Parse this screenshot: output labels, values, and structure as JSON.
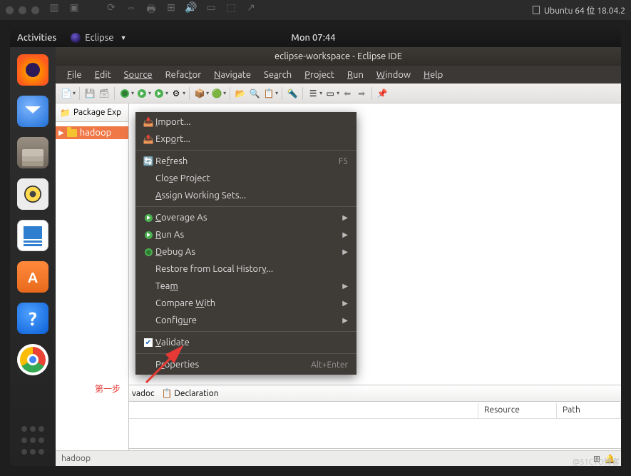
{
  "vm": {
    "title": "Ubuntu 64 位 18.04.2"
  },
  "ubuntu": {
    "activities": "Activities",
    "app_name": "Eclipse",
    "clock": "Mon 07:44"
  },
  "dock": {
    "firefox": "firefox",
    "thunderbird": "thunderbird",
    "files": "files",
    "rhythmbox": "rhythmbox",
    "writer": "libreoffice-writer",
    "software": "ubuntu-software",
    "help": "?",
    "chrome": "chrome",
    "apps": "show-apps"
  },
  "eclipse": {
    "title": "eclipse-workspace - Eclipse IDE",
    "menu": {
      "file": "File",
      "edit": "Edit",
      "source": "Source",
      "refactor": "Refactor",
      "navigate": "Navigate",
      "search": "Search",
      "project": "Project",
      "run": "Run",
      "window": "Window",
      "help": "Help"
    },
    "pkg_tab": "Package Exp",
    "tree": {
      "item0": "hadoop"
    },
    "bottom": {
      "javadoc": "vadoc",
      "declaration": "Declaration"
    },
    "table": {
      "desc": "",
      "resource": "Resource",
      "path": "Path"
    },
    "status": "hadoop"
  },
  "context_menu": {
    "import": "Import...",
    "export": "Export...",
    "refresh": "Refresh",
    "refresh_key": "F5",
    "close_project": "Close Project",
    "assign": "Assign Working Sets...",
    "coverage": "Coverage As",
    "run_as": "Run As",
    "debug_as": "Debug As",
    "restore": "Restore from Local History...",
    "team": "Team",
    "compare": "Compare With",
    "configure": "Configure",
    "validate": "Validate",
    "properties": "Properties",
    "properties_key": "Alt+Enter"
  },
  "annotation": {
    "step1": "第一步"
  },
  "watermark": "@51CTO博客"
}
